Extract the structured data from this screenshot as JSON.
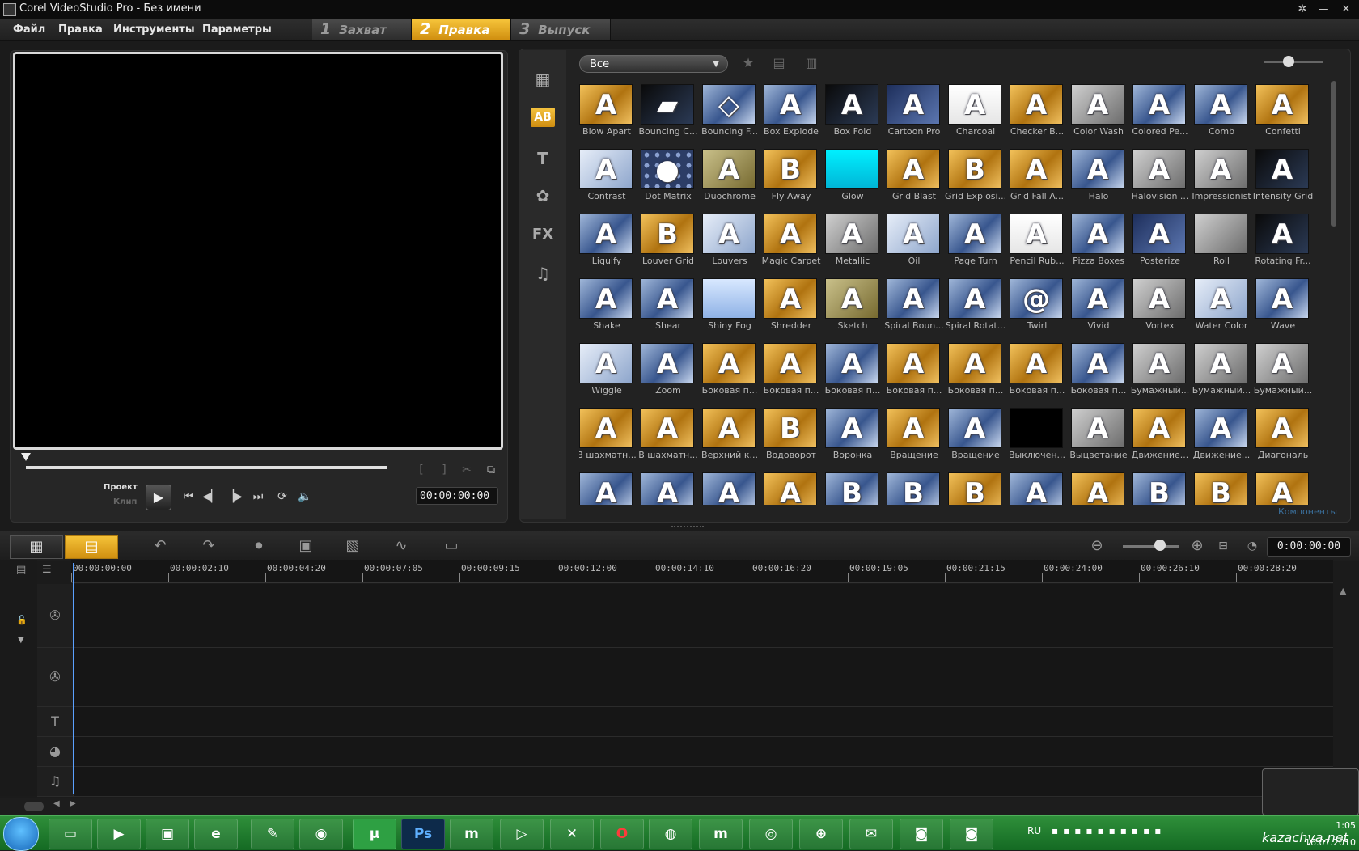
{
  "window": {
    "title": "Corel VideoStudio Pro - Без имени"
  },
  "menu": [
    "Файл",
    "Правка",
    "Инструменты",
    "Параметры"
  ],
  "steps": [
    {
      "num": "1",
      "label": "Захват",
      "active": false
    },
    {
      "num": "2",
      "label": "Правка",
      "active": true
    },
    {
      "num": "3",
      "label": "Выпуск",
      "active": false
    }
  ],
  "preview": {
    "project_label": "Проект",
    "clip_label": "Клип",
    "timecode": "00:00:00:00"
  },
  "library": {
    "filter": "Все",
    "components_label": "Компоненты",
    "selected_category_icon": "AB",
    "items": [
      {
        "label": "Blow Apart",
        "g": "A",
        "c": "gold"
      },
      {
        "label": "Bouncing C...",
        "g": "▰",
        "c": "dark"
      },
      {
        "label": "Bouncing F...",
        "g": "◇",
        "c": "blue"
      },
      {
        "label": "Box Explode",
        "g": "A",
        "c": "blue"
      },
      {
        "label": "Box Fold",
        "g": "A",
        "c": "dark"
      },
      {
        "label": "Cartoon Pro",
        "g": "A",
        "c": "navy"
      },
      {
        "label": "Charcoal",
        "g": "A",
        "c": "white"
      },
      {
        "label": "Checker B...",
        "g": "A",
        "c": "gold"
      },
      {
        "label": "Color Wash",
        "g": "A",
        "c": "grey"
      },
      {
        "label": "Colored Pe...",
        "g": "A",
        "c": "blue"
      },
      {
        "label": "Comb",
        "g": "A",
        "c": "blue"
      },
      {
        "label": "Confetti",
        "g": "A",
        "c": "gold"
      },
      {
        "label": "Contrast",
        "g": "A",
        "c": "light"
      },
      {
        "label": "Dot Matrix",
        "g": "●",
        "c": "dots"
      },
      {
        "label": "Duochrome",
        "g": "A",
        "c": "olive"
      },
      {
        "label": "Fly Away",
        "g": "B",
        "c": "gold"
      },
      {
        "label": "Glow",
        "g": "",
        "c": "cyan"
      },
      {
        "label": "Grid Blast",
        "g": "A",
        "c": "gold"
      },
      {
        "label": "Grid Explosi...",
        "g": "B",
        "c": "gold"
      },
      {
        "label": "Grid Fall A...",
        "g": "A",
        "c": "gold"
      },
      {
        "label": "Halo",
        "g": "A",
        "c": "blue"
      },
      {
        "label": "Halovision ...",
        "g": "A",
        "c": "grey"
      },
      {
        "label": "Impressionist",
        "g": "A",
        "c": "grey"
      },
      {
        "label": "Intensity Grid",
        "g": "A",
        "c": "dark"
      },
      {
        "label": "Liquify",
        "g": "A",
        "c": "blue"
      },
      {
        "label": "Louver Grid",
        "g": "B",
        "c": "gold"
      },
      {
        "label": "Louvers",
        "g": "A",
        "c": "light"
      },
      {
        "label": "Magic Carpet",
        "g": "A",
        "c": "gold"
      },
      {
        "label": "Metallic",
        "g": "A",
        "c": "grey"
      },
      {
        "label": "Oil",
        "g": "A",
        "c": "light"
      },
      {
        "label": "Page Turn",
        "g": "A",
        "c": "blue"
      },
      {
        "label": "Pencil Rub...",
        "g": "A",
        "c": "white"
      },
      {
        "label": "Pizza Boxes",
        "g": "A",
        "c": "blue"
      },
      {
        "label": "Posterize",
        "g": "A",
        "c": "navy"
      },
      {
        "label": "Roll",
        "g": "",
        "c": "grey"
      },
      {
        "label": "Rotating Fr...",
        "g": "A",
        "c": "dark"
      },
      {
        "label": "Shake",
        "g": "A",
        "c": "blue"
      },
      {
        "label": "Shear",
        "g": "A",
        "c": "blue"
      },
      {
        "label": "Shiny Fog",
        "g": "",
        "c": "sky"
      },
      {
        "label": "Shredder",
        "g": "A",
        "c": "gold"
      },
      {
        "label": "Sketch",
        "g": "A",
        "c": "olive"
      },
      {
        "label": "Spiral Boun...",
        "g": "A",
        "c": "blue"
      },
      {
        "label": "Spiral Rotat...",
        "g": "A",
        "c": "blue"
      },
      {
        "label": "Twirl",
        "g": "@",
        "c": "blue"
      },
      {
        "label": "Vivid",
        "g": "A",
        "c": "blue"
      },
      {
        "label": "Vortex",
        "g": "A",
        "c": "grey"
      },
      {
        "label": "Water Color",
        "g": "A",
        "c": "light"
      },
      {
        "label": "Wave",
        "g": "A",
        "c": "blue"
      },
      {
        "label": "Wiggle",
        "g": "A",
        "c": "light"
      },
      {
        "label": "Zoom",
        "g": "A",
        "c": "blue"
      },
      {
        "label": "Боковая п...",
        "g": "A",
        "c": "gold"
      },
      {
        "label": "Боковая п...",
        "g": "A",
        "c": "gold"
      },
      {
        "label": "Боковая п...",
        "g": "A",
        "c": "blue"
      },
      {
        "label": "Боковая п...",
        "g": "A",
        "c": "gold"
      },
      {
        "label": "Боковая п...",
        "g": "A",
        "c": "gold"
      },
      {
        "label": "Боковая п...",
        "g": "A",
        "c": "gold"
      },
      {
        "label": "Боковая п...",
        "g": "A",
        "c": "blue"
      },
      {
        "label": "Бумажный...",
        "g": "A",
        "c": "grey"
      },
      {
        "label": "Бумажный...",
        "g": "A",
        "c": "grey"
      },
      {
        "label": "Бумажный...",
        "g": "A",
        "c": "grey"
      },
      {
        "label": "В шахматн...",
        "g": "A",
        "c": "gold"
      },
      {
        "label": "В шахматн...",
        "g": "A",
        "c": "gold"
      },
      {
        "label": "Верхний к...",
        "g": "A",
        "c": "gold"
      },
      {
        "label": "Водоворот",
        "g": "B",
        "c": "gold"
      },
      {
        "label": "Воронка",
        "g": "A",
        "c": "blue"
      },
      {
        "label": "Вращение",
        "g": "A",
        "c": "gold"
      },
      {
        "label": "Вращение",
        "g": "A",
        "c": "blue"
      },
      {
        "label": "Выключен...",
        "g": "",
        "c": "black"
      },
      {
        "label": "Выцветание",
        "g": "A",
        "c": "grey"
      },
      {
        "label": "Движение...",
        "g": "A",
        "c": "gold"
      },
      {
        "label": "Движение...",
        "g": "A",
        "c": "blue"
      },
      {
        "label": "Диагональ",
        "g": "A",
        "c": "gold"
      },
      {
        "label": "",
        "g": "A",
        "c": "blue"
      },
      {
        "label": "",
        "g": "A",
        "c": "blue"
      },
      {
        "label": "",
        "g": "A",
        "c": "blue"
      },
      {
        "label": "",
        "g": "A",
        "c": "gold"
      },
      {
        "label": "",
        "g": "B",
        "c": "blue"
      },
      {
        "label": "",
        "g": "B",
        "c": "blue"
      },
      {
        "label": "",
        "g": "B",
        "c": "gold"
      },
      {
        "label": "",
        "g": "A",
        "c": "blue"
      },
      {
        "label": "",
        "g": "A",
        "c": "gold"
      },
      {
        "label": "",
        "g": "B",
        "c": "blue"
      },
      {
        "label": "",
        "g": "B",
        "c": "gold"
      },
      {
        "label": "",
        "g": "A",
        "c": "gold"
      }
    ]
  },
  "timeline": {
    "timecode": "0:00:00:00",
    "ruler": [
      "00:00:00:00",
      "00:00:02:10",
      "00:00:04:20",
      "00:00:07:05",
      "00:00:09:15",
      "00:00:12:00",
      "00:00:14:10",
      "00:00:16:20",
      "00:00:19:05",
      "00:00:21:15",
      "00:00:24:00",
      "00:00:26:10",
      "00:00:28:20"
    ]
  },
  "taskbar": {
    "lang": "RU",
    "time": "1:05",
    "date": "16.07.2010",
    "watermark": "kazachya.net"
  },
  "colors": {
    "accent": "#f0b429",
    "background": "#1b1b1b",
    "taskbar": "#1f7d2e"
  }
}
